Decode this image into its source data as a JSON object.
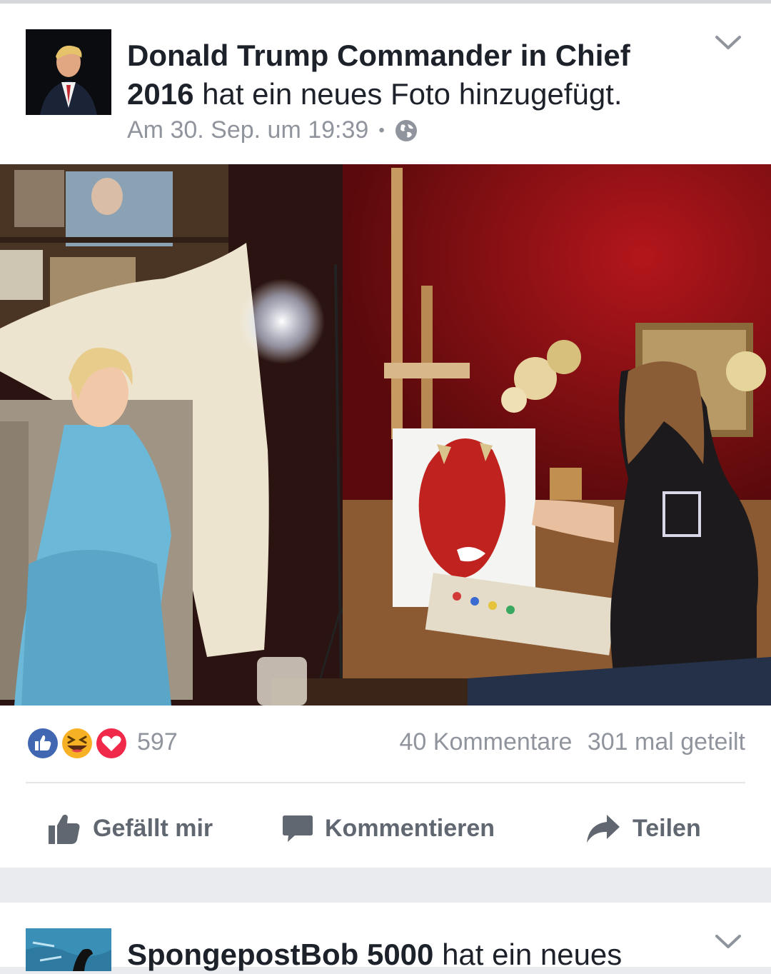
{
  "post1": {
    "author": "Donald Trump Commander in Chief 2016",
    "action": "hat ein neues Foto hinzugefügt.",
    "timestamp": "Am 30. Sep. um 19:39",
    "separator": "•",
    "privacy_icon": "globe-icon",
    "menu_icon": "chevron-down-icon",
    "reactions": {
      "icons": [
        "like-reaction-icon",
        "haha-reaction-icon",
        "love-reaction-icon"
      ],
      "count": "597",
      "comments": "40 Kommentare",
      "shares": "301 mal geteilt"
    },
    "actions": {
      "like": "Gefällt mir",
      "comment": "Kommentieren",
      "share": "Teilen"
    }
  },
  "post2": {
    "author": "SpongepostBob 5000",
    "action": "hat ein neues",
    "menu_icon": "chevron-down-icon"
  },
  "colors": {
    "background": "#e9ebee",
    "like_blue": "#4267b2",
    "love_red": "#f0284a",
    "haha_yellow": "#f7b125",
    "muted_text": "#90949c",
    "action_text": "#606770"
  }
}
